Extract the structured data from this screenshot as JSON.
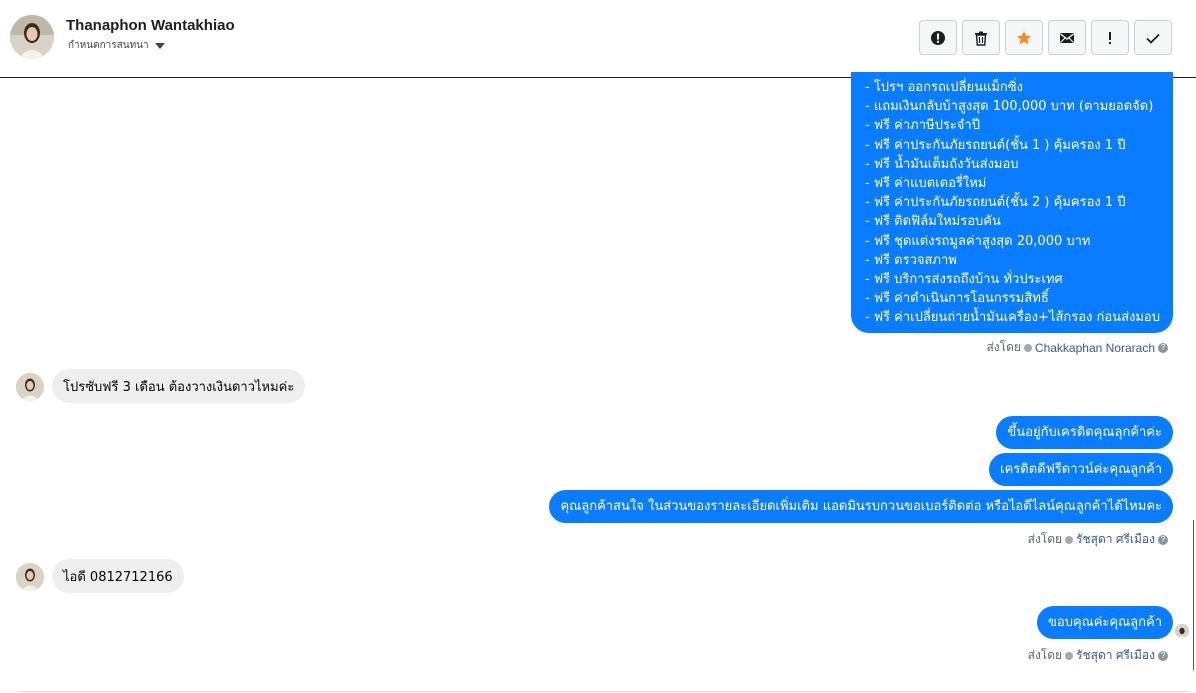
{
  "header": {
    "contact_name": "Thanaphon Wantakhiao",
    "conversation_status": "กำหนดการสนทนา",
    "toolbar": [
      {
        "name": "mark-spam-button",
        "icon": "alert-circle-icon"
      },
      {
        "name": "delete-button",
        "icon": "trash-icon"
      },
      {
        "name": "star-button",
        "icon": "star-icon",
        "color": "#f28c28"
      },
      {
        "name": "mark-unread-button",
        "icon": "envelope-icon"
      },
      {
        "name": "follow-up-button",
        "icon": "exclamation-icon"
      },
      {
        "name": "mark-done-button",
        "icon": "check-icon"
      }
    ]
  },
  "messages": {
    "promo_list": [
      "- โปรฯ ออกรถเปลี่ยนแม็กซิ่ง",
      "- แถมเงินกลับบ้าสูงสุด 100,000 บาท (ตามยอดจัด)",
      "- ฟรี ค่าภาษีประจำปี",
      "- ฟรี ค่าประกันภัยรถยนต์(ชั้น 1 ) คุ้มครอง 1 ปี",
      "- ฟรี น้ำมันเต็มถังวันส่งมอบ",
      "- ฟรี ค่าแบตเตอรี่ใหม่",
      "- ฟรี ค่าประกันภัยรถยนต์(ชั้น 2 ) คุ้มครอง 1 ปี",
      "- ฟรี ติดฟิล์มใหม่รอบคัน",
      "- ฟรี ชุดแต่งรถมูลค่าสูงสุด 20,000 บาท",
      "- ฟรี ตรวจสภาพ",
      "- ฟรี บริการส่งรถถึงบ้าน ทั่วประเทศ",
      "- ฟรี ค่าดำเนินการโอนกรรมสิทธิ์",
      "- ฟรี ค่าเปลี่ยนถ่ายน้ำมันเครื่อง+ไส้กรอง ก่อนส่งมอบ"
    ],
    "sent_by_label": "ส่งโดย",
    "sent_by_1": "Chakkaphan Norarach",
    "incoming_1": "โปรซับฟรี 3 เดือน ต้องวางเงินดาวไหมค่ะ",
    "outgoing_1": "ขึ้นอยู่กับเครดิตคุณลุกค้าค่ะ",
    "outgoing_2": "เครดิตดีฟรีดาวน์ค่ะคุณลูกค้า",
    "outgoing_3": "คุณลูกค้าสนใจ ในส่วนของรายละเอียดเพิ่มเติม แอดมินรบกวนขอเบอร์ติดต่อ หรือไอดีไลน์คุณลูกค้าได้ไหมคะ",
    "sent_by_2": "รัชสุดา ศรีเมือง",
    "incoming_2": "ไอดี 0812712166",
    "outgoing_4": "ขอบคุณค่ะคุณลูกค้า",
    "sent_by_3": "รัชสุดา ศรีเมือง",
    "help_glyph": "?"
  }
}
